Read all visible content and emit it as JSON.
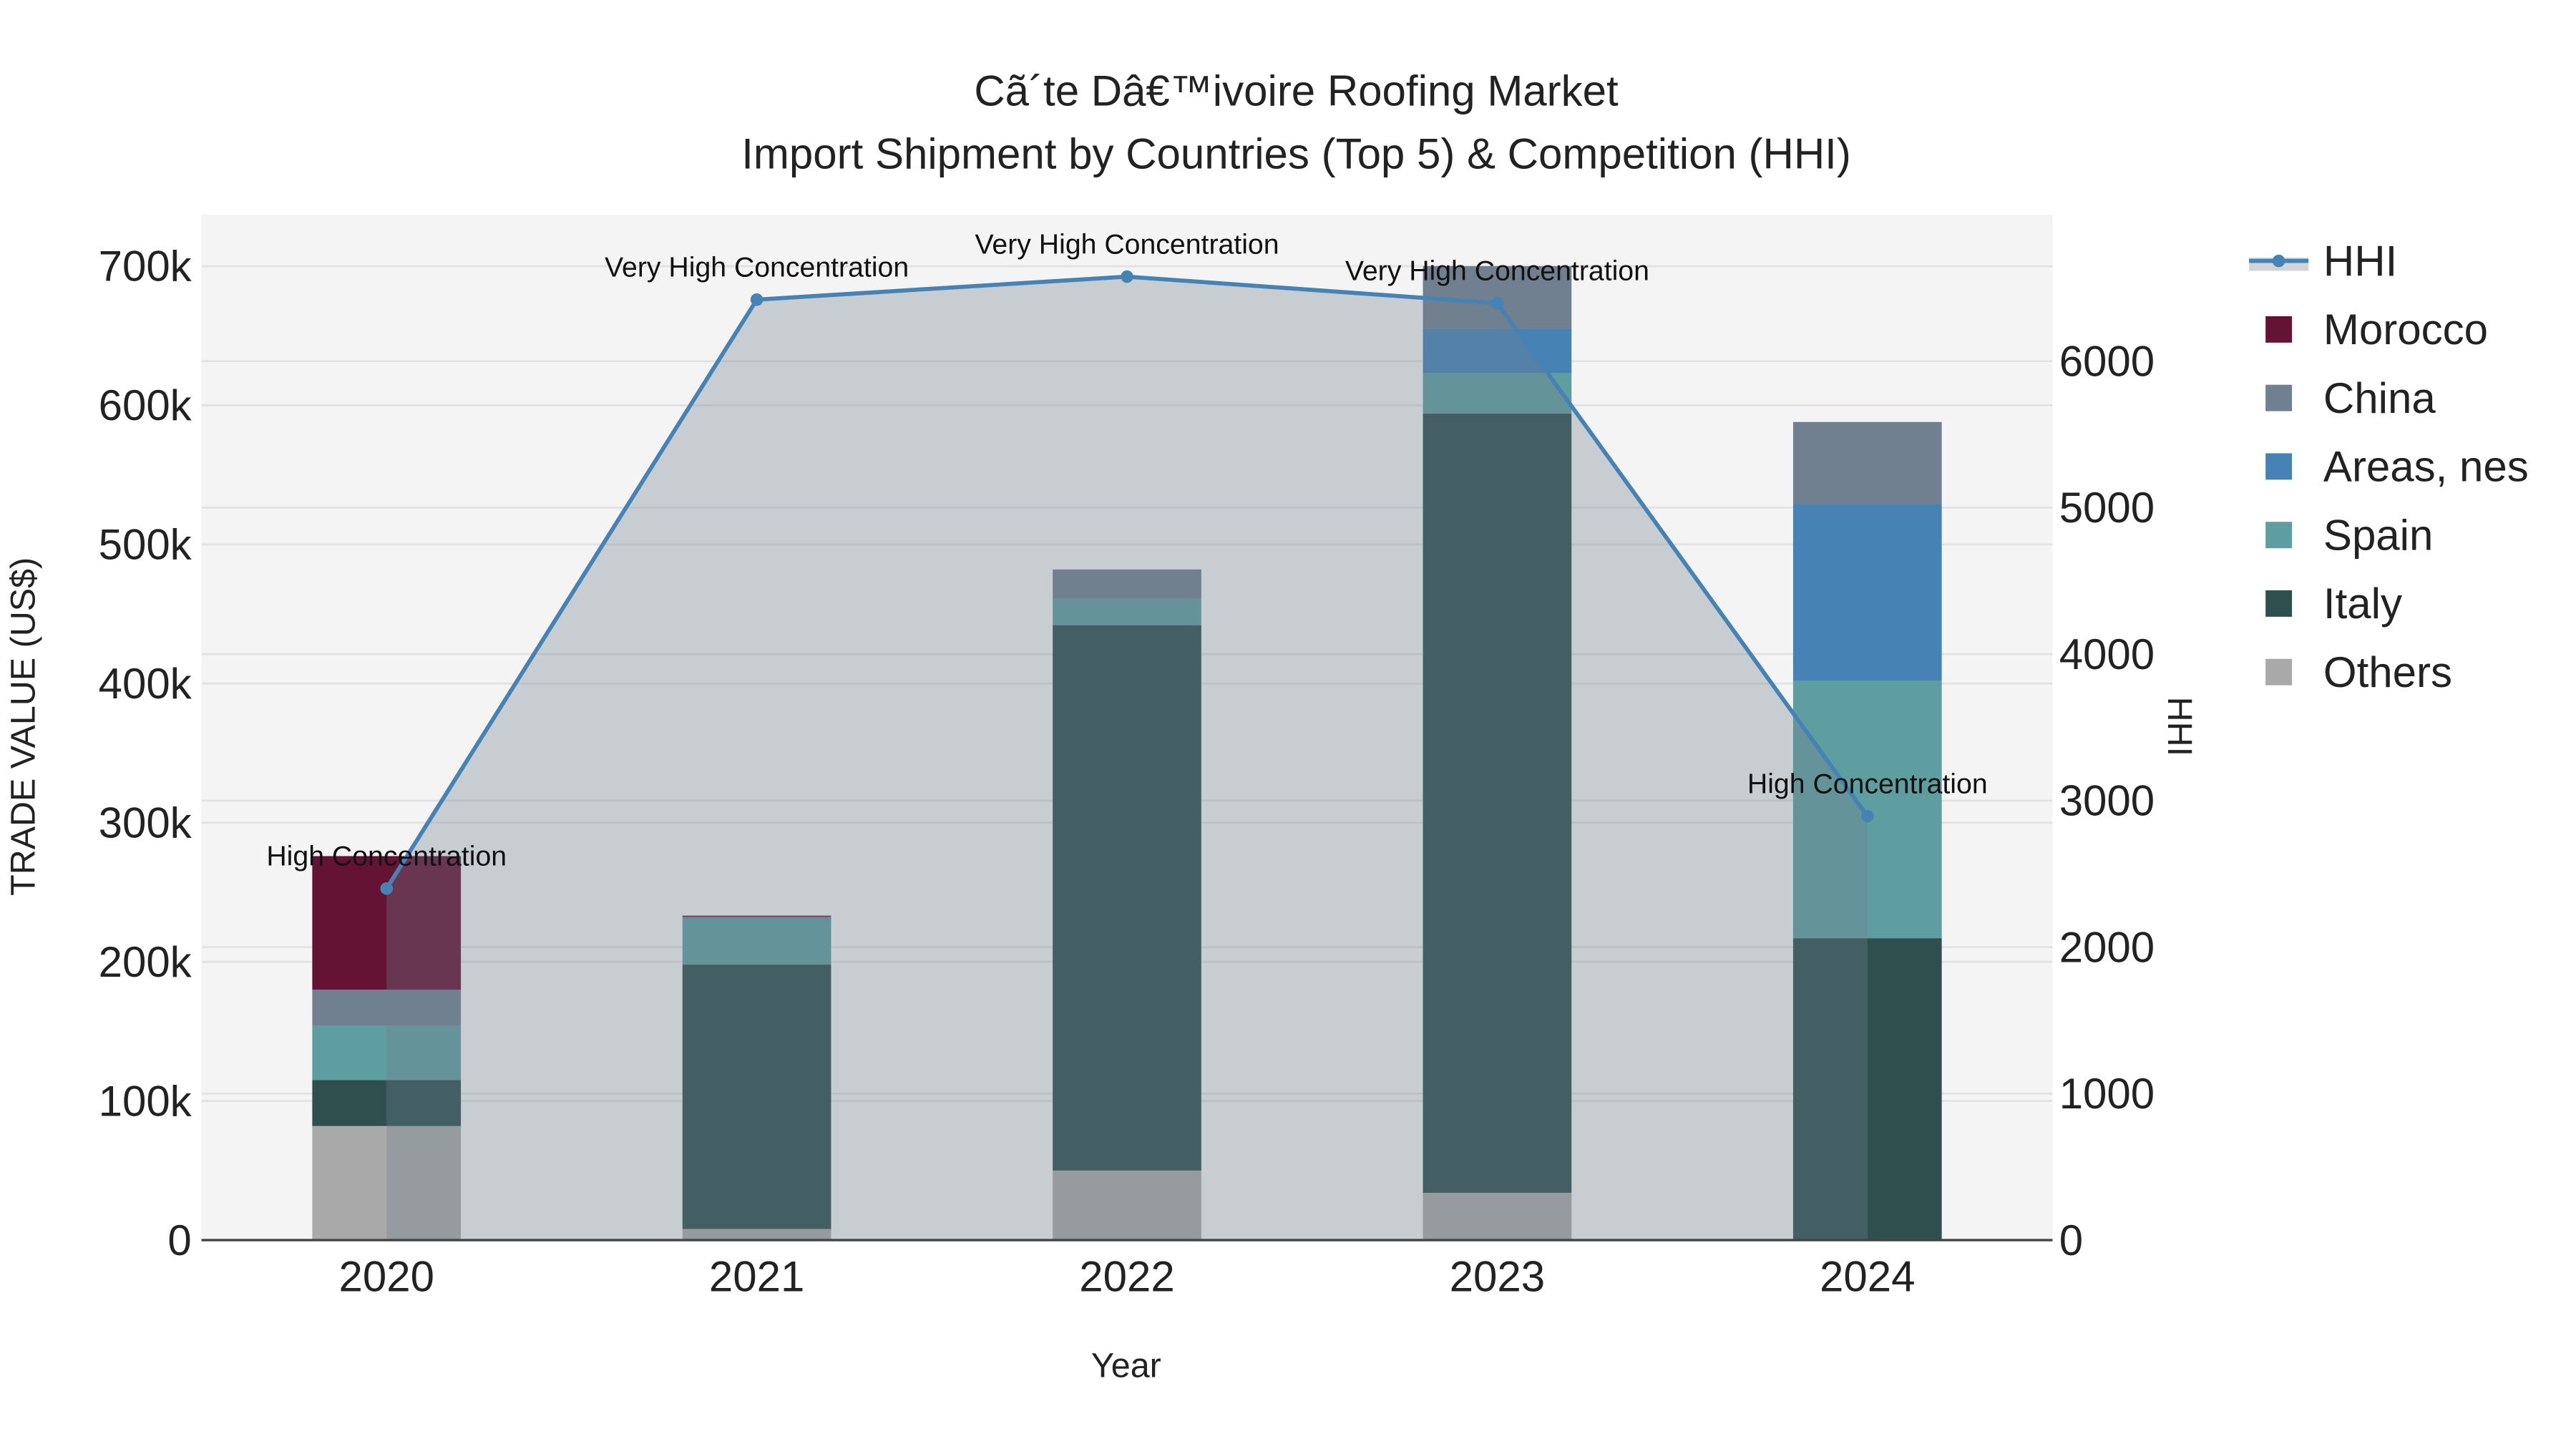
{
  "chart_data": {
    "type": "bar",
    "title_line1": "Cã´te Dâ€™ivoire Roofing Market",
    "title_line2": "Import Shipment by Countries (Top 5) & Competition (HHI)",
    "xlabel": "Year",
    "ylabel": "TRADE VALUE (US$)",
    "y2label": "HHI",
    "categories": [
      "2020",
      "2021",
      "2022",
      "2023",
      "2024"
    ],
    "ylim": [
      0,
      737000
    ],
    "y2lim": [
      0,
      7000
    ],
    "yticks": [
      0,
      100000,
      200000,
      300000,
      400000,
      500000,
      600000,
      700000
    ],
    "ytick_labels": [
      "0",
      "100k",
      "200k",
      "300k",
      "400k",
      "500k",
      "600k",
      "700k"
    ],
    "y2ticks": [
      0,
      1000,
      2000,
      3000,
      4000,
      5000,
      6000
    ],
    "y2tick_labels": [
      "0",
      "1000",
      "2000",
      "3000",
      "4000",
      "5000",
      "6000"
    ],
    "stacked": true,
    "series": [
      {
        "name": "Others",
        "color": "#A9A9A9",
        "values": [
          82000,
          8000,
          50000,
          34000,
          0
        ]
      },
      {
        "name": "Italy",
        "color": "#2F4F4F",
        "values": [
          33000,
          190000,
          392000,
          560000,
          217000
        ]
      },
      {
        "name": "Spain",
        "color": "#5F9EA0",
        "values": [
          39000,
          33000,
          19000,
          29000,
          185000
        ]
      },
      {
        "name": "Areas, nes",
        "color": "#4682B4",
        "values": [
          0,
          0,
          0,
          32000,
          127000
        ]
      },
      {
        "name": "China",
        "color": "#708090",
        "values": [
          26000,
          1500,
          21000,
          45000,
          59000
        ]
      },
      {
        "name": "Morocco",
        "color": "#641334",
        "values": [
          96000,
          700,
          0,
          0,
          0
        ]
      }
    ],
    "hhi": {
      "name": "HHI",
      "color": "#4682B4",
      "fill": "rgba(112,128,144,0.33)",
      "values": [
        2400,
        6420,
        6577,
        6396,
        2894
      ],
      "annotations": [
        "High Concentration",
        "Very High Concentration",
        "Very High Concentration",
        "Very High Concentration",
        "High Concentration"
      ]
    },
    "legend_order": [
      "HHI",
      "Morocco",
      "China",
      "Areas, nes",
      "Spain",
      "Italy",
      "Others"
    ],
    "legend_placement": "right",
    "grid": true
  }
}
